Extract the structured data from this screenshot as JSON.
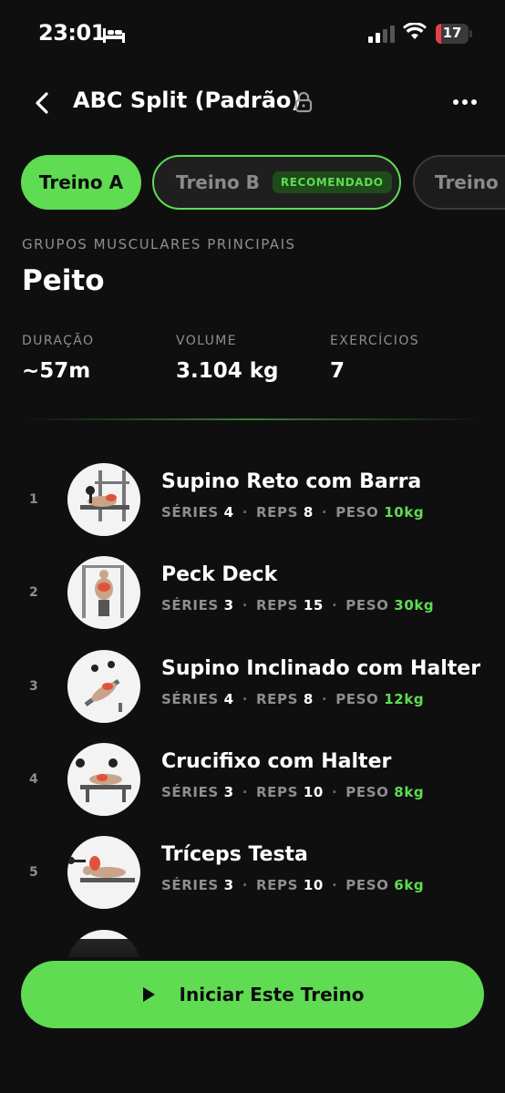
{
  "status_bar": {
    "time": "23:01",
    "battery": "17",
    "battery_level": 0.17
  },
  "header": {
    "title": "ABC Split (Padrão)"
  },
  "tabs": [
    {
      "label": "Treino A",
      "selected": true
    },
    {
      "label": "Treino B",
      "badge": "RECOMENDADO"
    },
    {
      "label": "Treino C"
    }
  ],
  "muscle_groups": {
    "label": "GRUPOS MUSCULARES PRINCIPAIS",
    "value": "Peito"
  },
  "stats": [
    {
      "label": "DURAÇÃO",
      "value": "~57m"
    },
    {
      "label": "VOLUME",
      "value": "3.104 kg"
    },
    {
      "label": "EXERCÍCIOS",
      "value": "7"
    }
  ],
  "meta_labels": {
    "series": "SÉRIES",
    "reps": "REPS",
    "peso": "PESO",
    "sep": "·"
  },
  "exercises": [
    {
      "index": "1",
      "name": "Supino Reto com Barra",
      "series": "4",
      "reps": "8",
      "peso": "10kg"
    },
    {
      "index": "2",
      "name": "Peck Deck",
      "series": "3",
      "reps": "15",
      "peso": "30kg"
    },
    {
      "index": "3",
      "name": "Supino Inclinado com Halter",
      "series": "4",
      "reps": "8",
      "peso": "12kg"
    },
    {
      "index": "4",
      "name": "Crucifixo com Halter",
      "series": "3",
      "reps": "10",
      "peso": "8kg"
    },
    {
      "index": "5",
      "name": "Tríceps Testa",
      "series": "3",
      "reps": "10",
      "peso": "6kg"
    }
  ],
  "cta": {
    "label": "Iniciar Este Treino"
  },
  "colors": {
    "accent": "#5fdc52",
    "background": "#0f0f0f",
    "muted": "#8e8e8e"
  }
}
